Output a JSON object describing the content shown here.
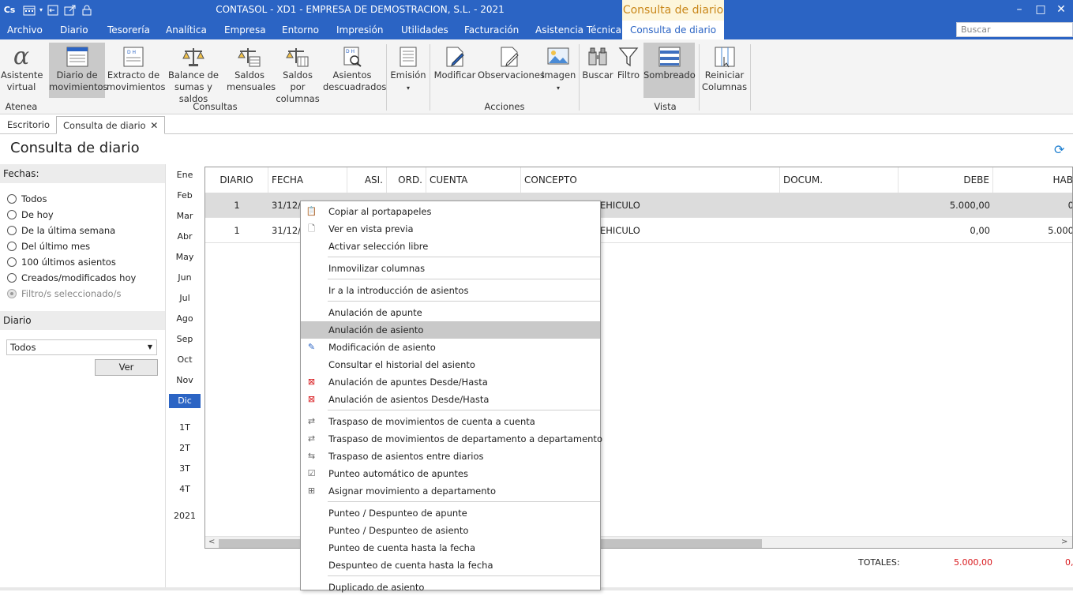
{
  "titlebar": {
    "app_icon": "Cs",
    "title": "CONTASOL - XD1 - EMPRESA DE DEMOSTRACION, S.L. - 2021",
    "context_title": "Consulta de diario",
    "minimize": "–",
    "maximize": "□",
    "close": "✕"
  },
  "menubar": {
    "items": [
      "Archivo",
      "Diario",
      "Tesorería",
      "Analítica",
      "Empresa",
      "Entorno",
      "Impresión",
      "Utilidades",
      "Facturación",
      "Asistencia Técnica"
    ],
    "active": "Consulta de diario",
    "search_placeholder": "Buscar"
  },
  "ribbon": {
    "buttons": [
      {
        "line1": "Asistente",
        "line2": "virtual",
        "icon": "alpha-icon"
      },
      {
        "line1": "Diario de",
        "line2": "movimientos",
        "icon": "journal-icon"
      },
      {
        "line1": "Extracto de",
        "line2": "movimientos",
        "icon": "statement-icon"
      },
      {
        "line1": "Balance de",
        "line2": "sumas y saldos",
        "icon": "scale-icon"
      },
      {
        "line1": "Saldos",
        "line2": "mensuales",
        "icon": "scale-table-icon"
      },
      {
        "line1": "Saldos por",
        "line2": "columnas",
        "icon": "scale-columns-icon"
      },
      {
        "line1": "Asientos",
        "line2": "descuadrados",
        "icon": "search-doc-icon"
      },
      {
        "line1": "Emisión",
        "line2": "▾",
        "icon": "print-doc-icon"
      },
      {
        "line1": "Modificar",
        "line2": "",
        "icon": "edit-doc-icon"
      },
      {
        "line1": "Observaciones",
        "line2": "",
        "icon": "notes-icon"
      },
      {
        "line1": "Imagen",
        "line2": "▾",
        "icon": "image-icon"
      },
      {
        "line1": "Buscar",
        "line2": "",
        "icon": "binoculars-icon"
      },
      {
        "line1": "Filtro",
        "line2": "",
        "icon": "filter-icon"
      },
      {
        "line1": "Sombreado",
        "line2": "",
        "icon": "shading-icon"
      },
      {
        "line1": "Reiniciar",
        "line2": "Columnas",
        "icon": "reset-columns-icon"
      }
    ],
    "groups": [
      "Atenea",
      "Consultas",
      "Acciones",
      "Vista"
    ]
  },
  "tabs": [
    "Escritorio",
    "Consulta de diario"
  ],
  "page": {
    "title": "Consulta de diario"
  },
  "filters": {
    "fechas_label": "Fechas:",
    "options": [
      "Todos",
      "De hoy",
      "De la última semana",
      "Del último mes",
      "100 últimos asientos",
      "Creados/modificados hoy",
      "Filtro/s seleccionado/s"
    ],
    "diario_label": "Diario",
    "diario_value": "Todos",
    "ver_label": "Ver"
  },
  "months": [
    "Ene",
    "Feb",
    "Mar",
    "Abr",
    "May",
    "Jun",
    "Jul",
    "Ago",
    "Sep",
    "Oct",
    "Nov",
    "Dic"
  ],
  "quarters": [
    "1T",
    "2T",
    "3T",
    "4T"
  ],
  "year": "2021",
  "grid": {
    "headers": [
      "DIARIO",
      "FECHA",
      "ASI.",
      "ORD.",
      "CUENTA",
      "CONCEPTO",
      "DOCUM.",
      "DEBE",
      "HAB"
    ],
    "rows": [
      {
        "diario": "1",
        "fecha": "31/12/2",
        "concepto": "EHICULO",
        "debe": "5.000,00",
        "haber": "0"
      },
      {
        "diario": "1",
        "fecha": "31/12/2",
        "concepto": "EHICULO",
        "debe": "0,00",
        "haber": "5.000"
      }
    ],
    "totals_label": "TOTALES:",
    "total_debe": "5.000,00",
    "total_haber": "0,"
  },
  "context_menu": {
    "items": [
      {
        "label": "Copiar al portapapeles",
        "icon": "clipboard-icon"
      },
      {
        "label": "Ver en vista previa",
        "icon": "preview-icon"
      },
      {
        "label": "Activar selección libre",
        "icon": ""
      },
      {
        "label": "Inmovilizar columnas",
        "icon": ""
      },
      {
        "label": "Ir a la introducción de asientos",
        "icon": ""
      },
      {
        "label": "Anulación de apunte",
        "icon": ""
      },
      {
        "label": "Anulación de asiento",
        "icon": ""
      },
      {
        "label": "Modificación de asiento",
        "icon": "edit-icon"
      },
      {
        "label": "Consultar el historial del asiento",
        "icon": ""
      },
      {
        "label": "Anulación de apuntes Desde/Hasta",
        "icon": "delete-range-icon"
      },
      {
        "label": "Anulación de asientos Desde/Hasta",
        "icon": "delete-range-icon"
      },
      {
        "label": "Traspaso de movimientos de cuenta a cuenta",
        "icon": "transfer-icon"
      },
      {
        "label": "Traspaso de movimientos de departamento a departamento",
        "icon": "transfer-icon"
      },
      {
        "label": "Traspaso de asientos entre diarios",
        "icon": "swap-icon"
      },
      {
        "label": "Punteo automático de apuntes",
        "icon": "check-list-icon"
      },
      {
        "label": "Asignar movimiento a departamento",
        "icon": "org-chart-icon"
      },
      {
        "label": "Punteo / Despunteo de apunte",
        "icon": ""
      },
      {
        "label": "Punteo / Despunteo de asiento",
        "icon": ""
      },
      {
        "label": "Punteo de cuenta hasta la fecha",
        "icon": ""
      },
      {
        "label": "Despunteo de cuenta hasta la fecha",
        "icon": ""
      },
      {
        "label": "Duplicado de asiento",
        "icon": ""
      }
    ]
  }
}
